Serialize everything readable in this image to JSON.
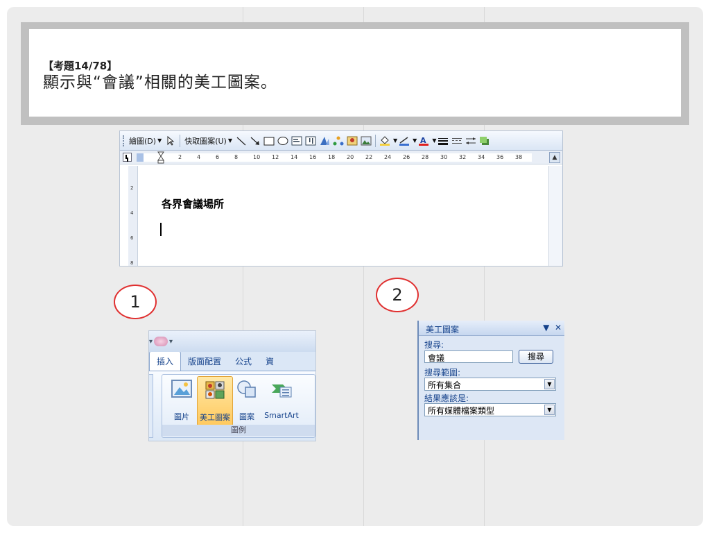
{
  "question": {
    "number": "【考題14/78】",
    "text": "顯示與“會議”相關的美工圖案。"
  },
  "word": {
    "draw_menu": "繪圖(D)",
    "autoshapes_menu": "快取圖案(U)",
    "ruler_ticks": [
      "2",
      "4",
      "6",
      "8",
      "10",
      "12",
      "14",
      "16",
      "18",
      "20",
      "22",
      "24",
      "26",
      "28",
      "30",
      "32",
      "34",
      "36",
      "38"
    ],
    "vruler_ticks": [
      "2",
      "4",
      "6",
      "8"
    ],
    "document_heading": "各界會議場所"
  },
  "steps": {
    "step1": "1",
    "step2": "2"
  },
  "ribbon": {
    "tabs": [
      "插入",
      "版面配置",
      "公式",
      "資"
    ],
    "buttons": {
      "picture": "圖片",
      "clipart": "美工圖案",
      "shapes": "圖案",
      "smartart": "SmartArt"
    },
    "group_label": "圖例"
  },
  "clipart_pane": {
    "title": "美工圖案",
    "search_label": "搜尋:",
    "search_value": "會議",
    "search_button": "搜尋",
    "scope_label": "搜尋範圍:",
    "scope_value": "所有集合",
    "results_label": "結果應該是:",
    "results_value": "所有媒體檔案類型"
  },
  "colors": {
    "accent_red": "#e03030",
    "office_blue": "#15428b"
  }
}
